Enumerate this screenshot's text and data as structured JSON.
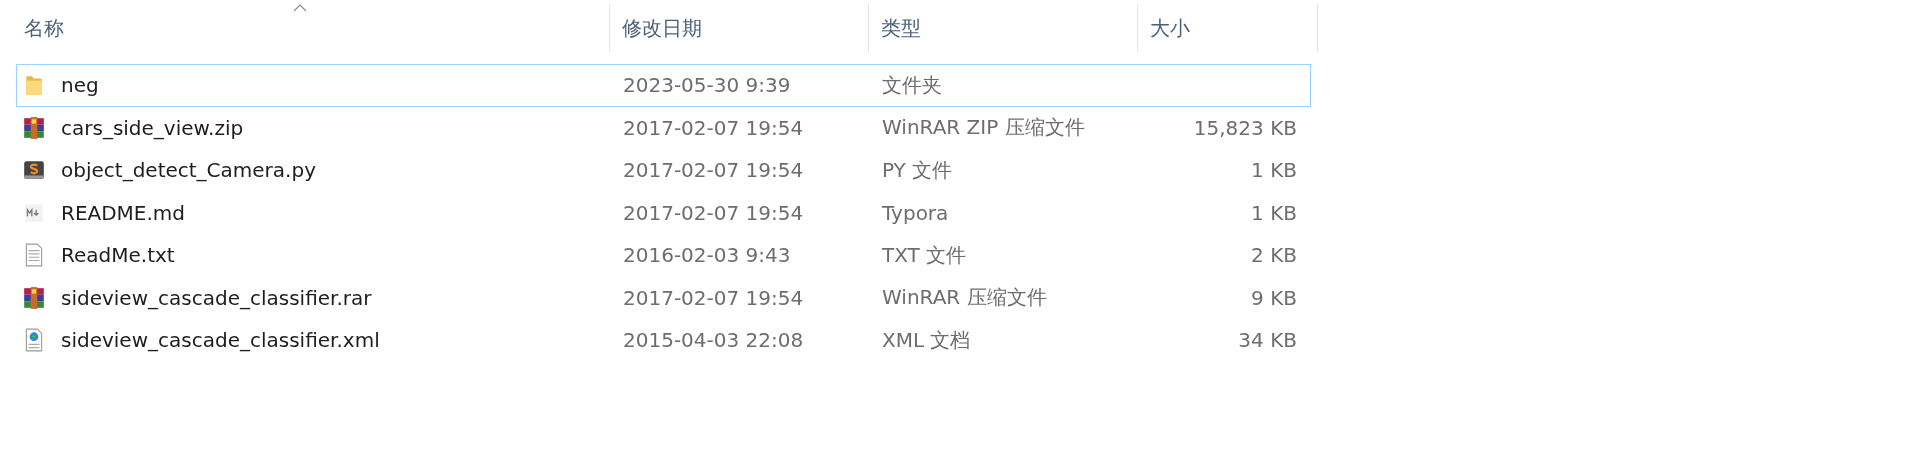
{
  "columns": [
    {
      "label": "名称",
      "sorted": true
    },
    {
      "label": "修改日期",
      "sorted": false
    },
    {
      "label": "类型",
      "sorted": false
    },
    {
      "label": "大小",
      "sorted": false
    }
  ],
  "files": [
    {
      "kind": "folder",
      "name": "neg",
      "date": "2023-05-30 9:39",
      "type": "文件夹",
      "focused": true
    },
    {
      "kind": "archive",
      "name": "cars_side_view.zip",
      "date": "2017-02-07 19:54",
      "type": "WinRAR ZIP 压缩文件",
      "size": "15,823 KB",
      "focused": false
    },
    {
      "kind": "script",
      "name": "object_detect_Camera.py",
      "date": "2017-02-07 19:54",
      "type": "PY 文件",
      "size": "1 KB",
      "focused": false
    },
    {
      "kind": "markdown",
      "name": "README.md",
      "date": "2017-02-07 19:54",
      "type": "Typora",
      "size": "1 KB",
      "focused": false
    },
    {
      "kind": "text",
      "name": "ReadMe.txt",
      "date": "2016-02-03 9:43",
      "type": "TXT 文件",
      "size": "2 KB",
      "focused": false
    },
    {
      "kind": "archive",
      "name": "sideview_cascade_classifier.rar",
      "date": "2017-02-07 19:54",
      "type": "WinRAR 压缩文件",
      "size": "9 KB",
      "focused": false
    },
    {
      "kind": "web",
      "name": "sideview_cascade_classifier.xml",
      "date": "2015-04-03 22:08",
      "type": "XML 文档",
      "size": "34 KB",
      "focused": false
    }
  ]
}
